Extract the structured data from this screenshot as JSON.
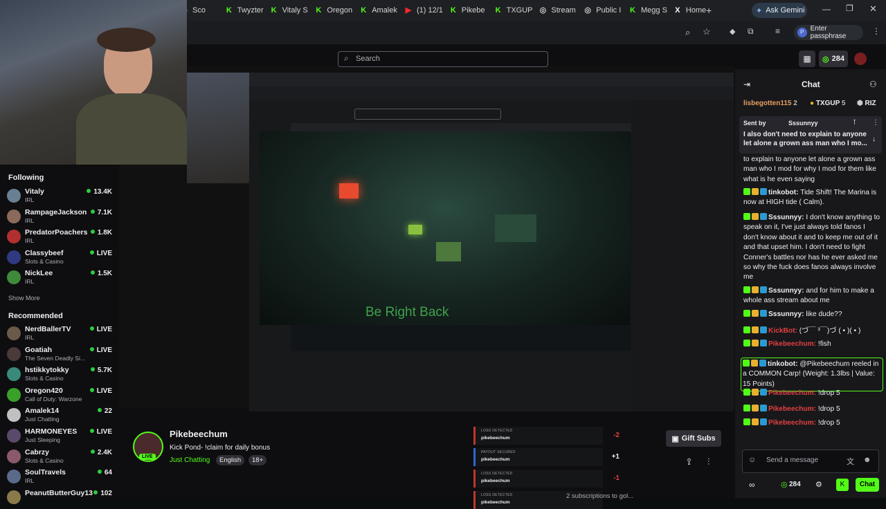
{
  "browser": {
    "tabs": [
      {
        "label": "Sco",
        "icon": "chrome-icon"
      },
      {
        "label": "Twyzter",
        "icon": "kick-icon"
      },
      {
        "label": "Vitaly S",
        "icon": "kick-icon"
      },
      {
        "label": "Oregon",
        "icon": "kick-icon"
      },
      {
        "label": "Amalek",
        "icon": "kick-icon"
      },
      {
        "label": "(1) 12/1",
        "icon": "youtube-icon"
      },
      {
        "label": "Pikebe",
        "icon": "kick-icon"
      },
      {
        "label": "TXGUP",
        "icon": "kick-icon"
      },
      {
        "label": "Stream",
        "icon": "globe-icon"
      },
      {
        "label": "Public I",
        "icon": "globe-icon"
      },
      {
        "label": "Megg S",
        "icon": "kick-icon"
      },
      {
        "label": "Home",
        "icon": "x-icon"
      }
    ],
    "ask_gemini": "Ask Gemini",
    "passphrase": "Enter passphrase"
  },
  "header": {
    "search_placeholder": "Search",
    "points": "284"
  },
  "sidebar": {
    "following_title": "Following",
    "following": [
      {
        "name": "Vitaly",
        "category": "IRL",
        "viewers": "13.4K",
        "color": "#6a7f91"
      },
      {
        "name": "RampageJackson",
        "category": "IRL",
        "viewers": "7.1K",
        "color": "#8a6a5a"
      },
      {
        "name": "PredatorPoachers",
        "category": "IRL",
        "viewers": "1.8K",
        "color": "#b03030"
      },
      {
        "name": "Classybeef",
        "category": "Slots & Casino",
        "viewers": "LIVE",
        "color": "#303a80"
      },
      {
        "name": "NickLee",
        "category": "IRL",
        "viewers": "1.5K",
        "color": "#3f8a3a"
      }
    ],
    "show_more": "Show More",
    "recommended_title": "Recommended",
    "recommended": [
      {
        "name": "NerdBallerTV",
        "category": "IRL",
        "viewers": "LIVE",
        "color": "#6a5a4a"
      },
      {
        "name": "Goatiah",
        "category": "The Seven Deadly Si...",
        "viewers": "LIVE",
        "color": "#4a3a3a"
      },
      {
        "name": "hstikkytokky",
        "category": "Slots & Casino",
        "viewers": "5.7K",
        "color": "#3a8a7a"
      },
      {
        "name": "Oregon420",
        "category": "Call of Duty: Warzone",
        "viewers": "LIVE",
        "color": "#3aa02a"
      },
      {
        "name": "Amalek14",
        "category": "Just Chatting",
        "viewers": "22",
        "color": "#c0c0c0"
      },
      {
        "name": "HARMONEYES",
        "category": "Just Sleeping",
        "viewers": "LIVE",
        "color": "#5a4a6a"
      },
      {
        "name": "Cabrzy",
        "category": "Slots & Casino",
        "viewers": "2.4K",
        "color": "#8a5a6a"
      },
      {
        "name": "SoulTravels",
        "category": "IRL",
        "viewers": "64",
        "color": "#5a6a8a"
      },
      {
        "name": "PeanutButterGuy13",
        "category": "",
        "viewers": "102",
        "color": "#8a7a4a"
      }
    ]
  },
  "stream": {
    "brb_text": "Be Right Back",
    "streamer": "Pikebeechum",
    "title": "Kick Pond- !claim for daily bonus",
    "category": "Just Chatting",
    "tags": [
      "English",
      "18+"
    ],
    "live_badge": "LIVE",
    "gift_subs": "Gift Subs",
    "subs_partial": "2 subscriptions to gol..."
  },
  "alerts": [
    {
      "label": "LOSS DETECTED",
      "name": "pikebeechum",
      "value": "-2",
      "color": "#e04040"
    },
    {
      "label": "PAYOUT SECURED",
      "name": "pikebeechum",
      "value": "+1",
      "color": "#efeff1"
    },
    {
      "label": "LOSS DETECTED",
      "name": "pikebeechum",
      "value": "-1",
      "color": "#e04040"
    },
    {
      "label": "LOSS DETECTED",
      "name": "pikebeechum",
      "value": "",
      "color": "#e04040"
    }
  ],
  "chat": {
    "title": "Chat",
    "top_gifters": [
      {
        "name": "lisbegotten115",
        "count": "2"
      },
      {
        "name": "TXGUP",
        "count": "5"
      },
      {
        "name": "RIZ",
        "count": ""
      }
    ],
    "pinned": {
      "sent_by": "Sent by",
      "user": "Sssunnyy",
      "text": "I also don't need to explain to anyone let alone a grown ass man who I mo..."
    },
    "messages": [
      {
        "user": "",
        "text": "to explain to anyone let alone a grown ass man who I mod for why I mod for them like what is he even saying",
        "color": "#efeff1"
      },
      {
        "user": "tinkobot:",
        "text": "Tide Shift! The Marina is now at HIGH tide ( Calm).",
        "color": "#efeff1"
      },
      {
        "user": "Sssunnyy:",
        "text": "I don't know anything to speak on it, I've just always told fanos I don't know about it and to keep me out of it and that upset him. I don't need to fight Conner's battles nor has he ever asked me so why the fuck does fanos always involve me",
        "color": "#efeff1"
      },
      {
        "user": "Sssunnyy:",
        "text": "and for him to make a whole ass stream about me",
        "color": "#efeff1"
      },
      {
        "user": "Sssunnyy:",
        "text": "like dude??",
        "color": "#efeff1"
      },
      {
        "user": "KickBot:",
        "text": "(づ￣ ³￣)づ ( • )( • )",
        "color": "#e04040"
      },
      {
        "user": "Pikebeechum:",
        "text": "!fish",
        "color": "#e04040"
      },
      {
        "user": "tinkobot:",
        "text": "@Pikebeechum reeled in a COMMON Carp! (Weight: 1.3lbs | Value: 15 Points)",
        "color": "#efeff1"
      },
      {
        "user": "Pikebeechum:",
        "text": "!drop 5",
        "color": "#e04040"
      },
      {
        "user": "Pikebeechum:",
        "text": "!drop 5",
        "color": "#e04040"
      },
      {
        "user": "Pikebeechum:",
        "text": "!drop 5",
        "color": "#e04040"
      }
    ],
    "input_placeholder": "Send a message",
    "points": "284",
    "chat_button": "Chat"
  },
  "colors": {
    "accent": "#53fc18",
    "live": "#2ecc40",
    "bg": "#0e0e10",
    "chat_bg": "#18181b"
  }
}
